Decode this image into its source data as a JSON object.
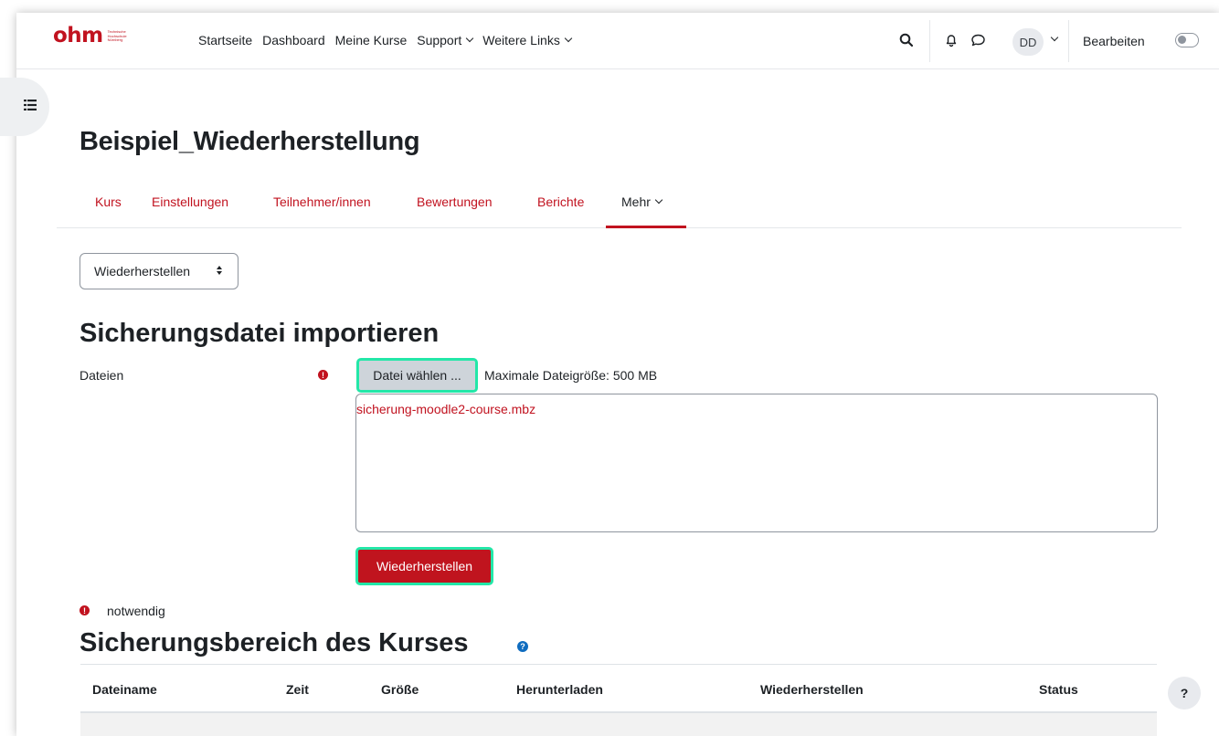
{
  "logo": {
    "main": "ohm",
    "sub_lines": [
      "Technische",
      "Hochschule",
      "Nürnberg"
    ]
  },
  "nav": {
    "items": [
      {
        "label": "Startseite"
      },
      {
        "label": "Dashboard"
      },
      {
        "label": "Meine Kurse"
      },
      {
        "label": "Support"
      },
      {
        "label": "Weitere Links"
      }
    ],
    "user_initials": "DD",
    "edit_mode_label": "Bearbeiten",
    "edit_mode_on": false,
    "icons": [
      "search-icon",
      "bell-icon",
      "message-icon",
      "chevron-down-icon",
      "drawer-icon"
    ]
  },
  "course": {
    "title": "Beispiel_Wiederherstellung",
    "tabs": [
      {
        "label": "Kurs"
      },
      {
        "label": "Einstellungen"
      },
      {
        "label": "Teilnehmer/innen"
      },
      {
        "label": "Bewertungen"
      },
      {
        "label": "Berichte"
      },
      {
        "label": "Mehr",
        "active": true
      }
    ]
  },
  "action_select": {
    "value": "Wiederherstellen"
  },
  "import_section": {
    "heading": "Sicherungsdatei importieren",
    "field_label": "Dateien",
    "choose_button": "Datei wählen ...",
    "max_size": "Maximale Dateigröße: 500 MB",
    "file_name": "sicherung-moodle2-course.mbz",
    "submit_button": "Wiederherstellen",
    "required_note": "notwendig"
  },
  "backup_area": {
    "heading": "Sicherungsbereich des Kurses",
    "columns": [
      "Dateiname",
      "Zeit",
      "Größe",
      "Herunterladen",
      "Wiederherstellen",
      "Status"
    ]
  },
  "help_button": "?",
  "colors": {
    "brand": "#c1121f",
    "highlight": "#23e7a8",
    "link_blue": "#0f6cbf"
  }
}
